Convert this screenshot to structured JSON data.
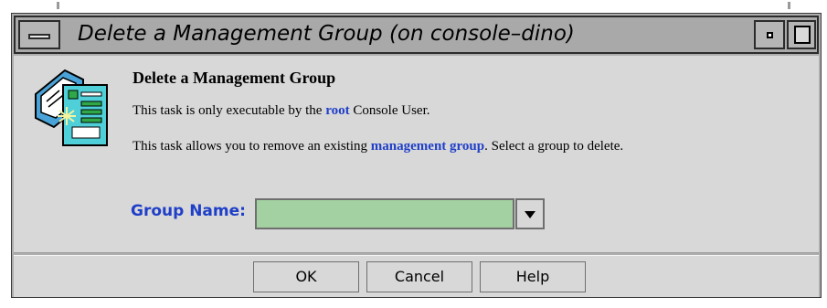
{
  "window": {
    "title": "Delete a Management Group (on console–dino)"
  },
  "task": {
    "heading": "Delete a Management Group",
    "line1_prefix": "This task is only executable by the ",
    "line1_link": "root",
    "line1_suffix": " Console User.",
    "line2_prefix": "This task allows you to remove an existing ",
    "line2_link": "management group",
    "line2_suffix": ". Select a group to delete."
  },
  "form": {
    "group_name_label": "Group Name:",
    "group_name_value": ""
  },
  "buttons": {
    "ok": "OK",
    "cancel": "Cancel",
    "help": "Help"
  },
  "colors": {
    "link": "#1f3fc8",
    "field_bg": "#a3d1a2",
    "panel_bg": "#d8d8d8"
  },
  "icons": [
    "window-menu-icon",
    "minimize-icon",
    "maximize-icon",
    "task-icon",
    "dropdown-arrow-icon"
  ]
}
